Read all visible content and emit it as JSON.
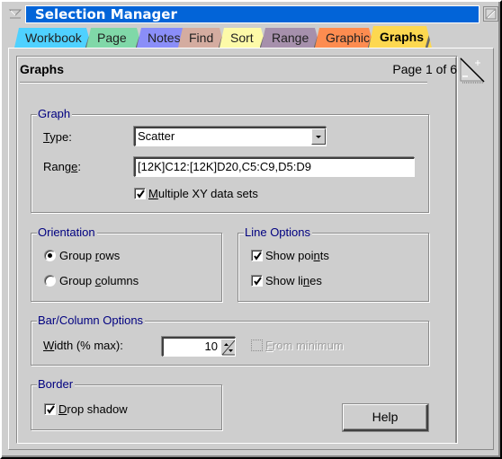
{
  "window": {
    "title": "Selection Manager"
  },
  "tabs": [
    {
      "label": "Workbook",
      "color": "#4fd1ff",
      "active": false
    },
    {
      "label": "Page",
      "color": "#80d8a8",
      "active": false
    },
    {
      "label": "Notes",
      "color": "#8a8ef8",
      "active": false
    },
    {
      "label": "Find",
      "color": "#d4aca0",
      "active": false
    },
    {
      "label": "Sort",
      "color": "#fdfaa8",
      "active": false
    },
    {
      "label": "Range",
      "color": "#a690ac",
      "active": false
    },
    {
      "label": "Graphic",
      "color": "#fd8c50",
      "active": false
    },
    {
      "label": "Graphs",
      "color": "#fdd850",
      "active": true
    }
  ],
  "page": {
    "title": "Graphs",
    "indicator": "Page 1 of 6"
  },
  "graph": {
    "legend": "Graph",
    "type_label_pre": "",
    "type_label_u": "T",
    "type_label_post": "ype:",
    "type_value": "Scatter",
    "range_label_pre": "Rang",
    "range_label_u": "e",
    "range_label_post": ":",
    "range_value": "[12K]C12:[12K]D20,C5:C9,D5:D9",
    "multiple_xy_u": "M",
    "multiple_xy_post": "ultiple XY data sets",
    "multiple_xy_checked": true
  },
  "orientation": {
    "legend": "Orientation",
    "group_rows_pre": "Group ",
    "group_rows_u": "r",
    "group_rows_post": "ows",
    "group_columns_pre": "Group ",
    "group_columns_u": "c",
    "group_columns_post": "olumns",
    "selected": "rows"
  },
  "line_options": {
    "legend": "Line Options",
    "show_points_pre": "Show poi",
    "show_points_u": "n",
    "show_points_post": "ts",
    "show_points_checked": true,
    "show_lines_pre": "Show li",
    "show_lines_u": "n",
    "show_lines_post": "es",
    "show_lines_checked": true
  },
  "bar_column": {
    "legend": "Bar/Column Options",
    "width_label_u": "W",
    "width_label_post": "idth (% max):",
    "width_value": "10",
    "from_minimum_u": "F",
    "from_minimum_post": "rom minimum",
    "from_minimum_checked": false,
    "from_minimum_enabled": false
  },
  "border": {
    "legend": "Border",
    "drop_shadow_u": "D",
    "drop_shadow_post": "rop shadow",
    "drop_shadow_checked": true
  },
  "buttons": {
    "help": "Help"
  }
}
